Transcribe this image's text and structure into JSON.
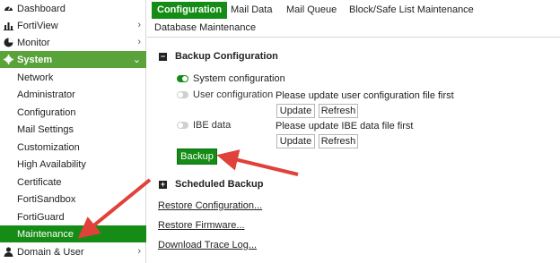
{
  "sidebar": {
    "items": [
      {
        "label": "Dashboard",
        "icon": "dashboard-icon"
      },
      {
        "label": "FortiView",
        "icon": "bar-chart-icon"
      },
      {
        "label": "Monitor",
        "icon": "pie-chart-icon"
      },
      {
        "label": "System",
        "icon": "gear-icon"
      },
      {
        "label": "Network"
      },
      {
        "label": "Administrator"
      },
      {
        "label": "Configuration"
      },
      {
        "label": "Mail Settings"
      },
      {
        "label": "Customization"
      },
      {
        "label": "High Availability"
      },
      {
        "label": "Certificate"
      },
      {
        "label": "FortiSandbox"
      },
      {
        "label": "FortiGuard"
      },
      {
        "label": "Maintenance"
      },
      {
        "label": "Domain & User",
        "icon": "user-icon"
      }
    ]
  },
  "tabs": {
    "items": [
      {
        "label": "Configuration"
      },
      {
        "label": "Mail Data"
      },
      {
        "label": "Mail Queue"
      },
      {
        "label": "Block/Safe List Maintenance"
      },
      {
        "label": "Database Maintenance"
      }
    ]
  },
  "backup": {
    "title": "Backup Configuration",
    "options": [
      {
        "label": "System configuration",
        "enabled": true
      },
      {
        "label": "User configuration",
        "enabled": false
      },
      {
        "label": "IBE data",
        "enabled": false
      }
    ],
    "user_note": "Please update user configuration file first",
    "ibe_note": "Please update IBE data file first",
    "update_label": "Update",
    "refresh_label": "Refresh",
    "backup_label": "Backup"
  },
  "scheduled": {
    "title": "Scheduled Backup"
  },
  "links": {
    "restore_config": "Restore Configuration...",
    "restore_firmware": "Restore Firmware...",
    "download_trace": "Download Trace Log..."
  },
  "colors": {
    "accent": "#148c15",
    "system_header": "#5aa23a",
    "arrow": "#e0413a"
  }
}
